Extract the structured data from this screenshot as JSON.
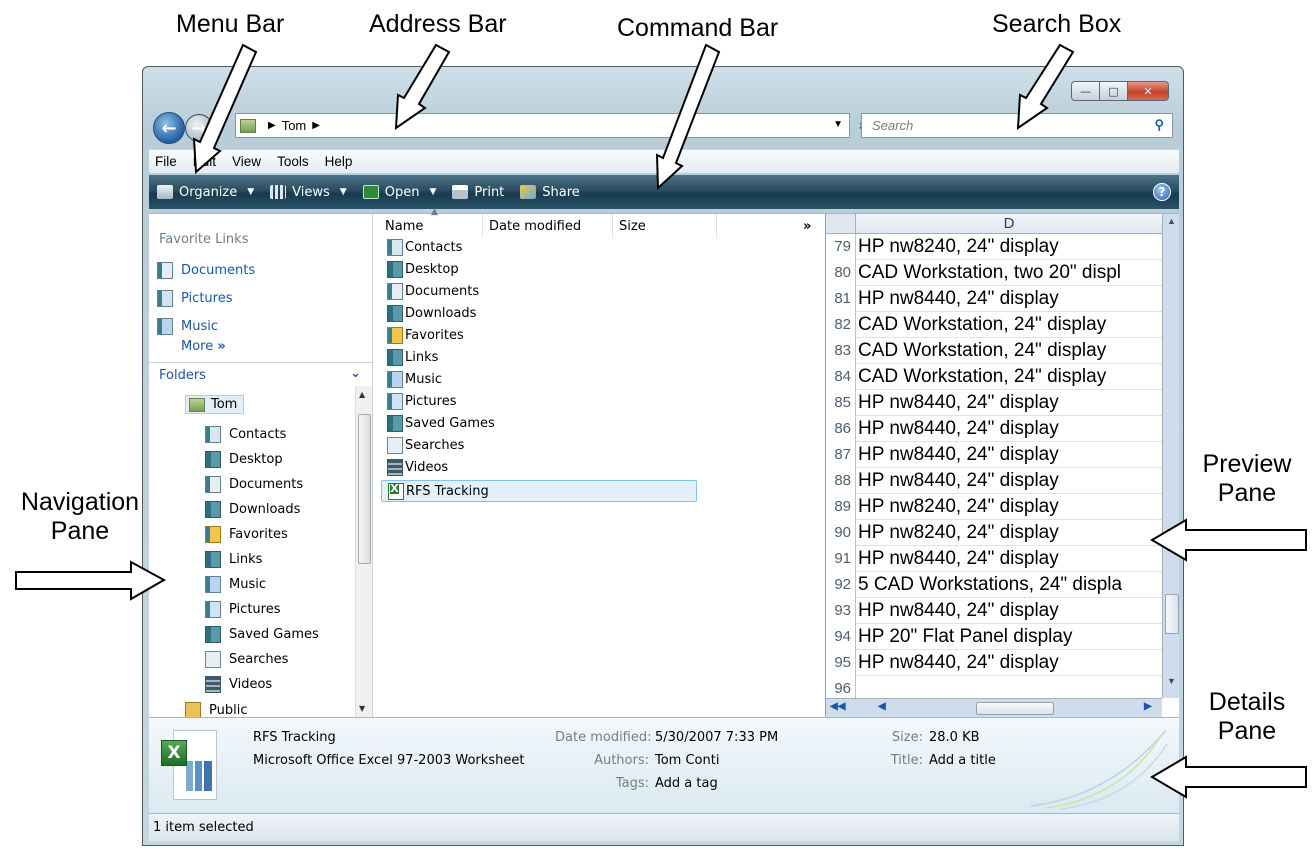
{
  "callouts": {
    "menu_bar": "Menu Bar",
    "address_bar": "Address Bar",
    "command_bar": "Command Bar",
    "search_box": "Search Box",
    "navigation_pane_1": "Navigation",
    "navigation_pane_2": "Pane",
    "preview_pane_1": "Preview",
    "preview_pane_2": "Pane",
    "details_pane_1": "Details",
    "details_pane_2": "Pane"
  },
  "address": {
    "crumb": "Tom"
  },
  "search": {
    "placeholder": "Search"
  },
  "menu": [
    "File",
    "Edit",
    "View",
    "Tools",
    "Help"
  ],
  "commands": {
    "organize": "Organize",
    "views": "Views",
    "open": "Open",
    "print": "Print",
    "share": "Share"
  },
  "favorite_links": {
    "title": "Favorite Links",
    "items": [
      "Documents",
      "Pictures",
      "Music"
    ],
    "more": "More"
  },
  "folders": {
    "title": "Folders",
    "root": "Tom",
    "children": [
      "Contacts",
      "Desktop",
      "Documents",
      "Downloads",
      "Favorites",
      "Links",
      "Music",
      "Pictures",
      "Saved Games",
      "Searches",
      "Videos"
    ],
    "next": "Public"
  },
  "file_list": {
    "columns": [
      "Name",
      "Date modified",
      "Size"
    ],
    "items": [
      "Contacts",
      "Desktop",
      "Documents",
      "Downloads",
      "Favorites",
      "Links",
      "Music",
      "Pictures",
      "Saved Games",
      "Searches",
      "Videos",
      "RFS Tracking"
    ],
    "selected": "RFS Tracking"
  },
  "preview": {
    "column": "D",
    "rows": [
      {
        "n": "79",
        "text": "HP nw8240, 24\" display"
      },
      {
        "n": "80",
        "text": "CAD Workstation, two 20\" displ"
      },
      {
        "n": "81",
        "text": "HP nw8440, 24\" display"
      },
      {
        "n": "82",
        "text": "CAD Workstation, 24\" display"
      },
      {
        "n": "83",
        "text": "CAD Workstation, 24\" display"
      },
      {
        "n": "84",
        "text": "CAD Workstation, 24\" display"
      },
      {
        "n": "85",
        "text": "HP nw8440, 24\" display"
      },
      {
        "n": "86",
        "text": "HP nw8440, 24\" display"
      },
      {
        "n": "87",
        "text": "HP nw8440, 24\" display"
      },
      {
        "n": "88",
        "text": "HP nw8440, 24\" display"
      },
      {
        "n": "89",
        "text": "HP nw8240, 24\" display"
      },
      {
        "n": "90",
        "text": "HP nw8240, 24\" display"
      },
      {
        "n": "91",
        "text": "HP nw8440, 24\" display"
      },
      {
        "n": "92",
        "text": "5 CAD Workstations, 24\" displa"
      },
      {
        "n": "93",
        "text": "HP nw8440, 24\" display"
      },
      {
        "n": "94",
        "text": "HP 20\" Flat Panel display"
      },
      {
        "n": "95",
        "text": "HP nw8440, 24\" display"
      },
      {
        "n": "96",
        "text": ""
      }
    ]
  },
  "details": {
    "file_name": "RFS Tracking",
    "file_type": "Microsoft Office Excel 97-2003 Worksheet",
    "date_modified_label": "Date modified:",
    "date_modified": "5/30/2007 7:33 PM",
    "authors_label": "Authors:",
    "authors": "Tom Conti",
    "tags_label": "Tags:",
    "tags": "Add a tag",
    "size_label": "Size:",
    "size": "28.0 KB",
    "title_label": "Title:",
    "title": "Add a title"
  },
  "status": "1 item selected",
  "colors": {
    "command_bar": "#2a4d60",
    "link_blue": "#1d56a5",
    "selection": "#e2f1fc"
  }
}
